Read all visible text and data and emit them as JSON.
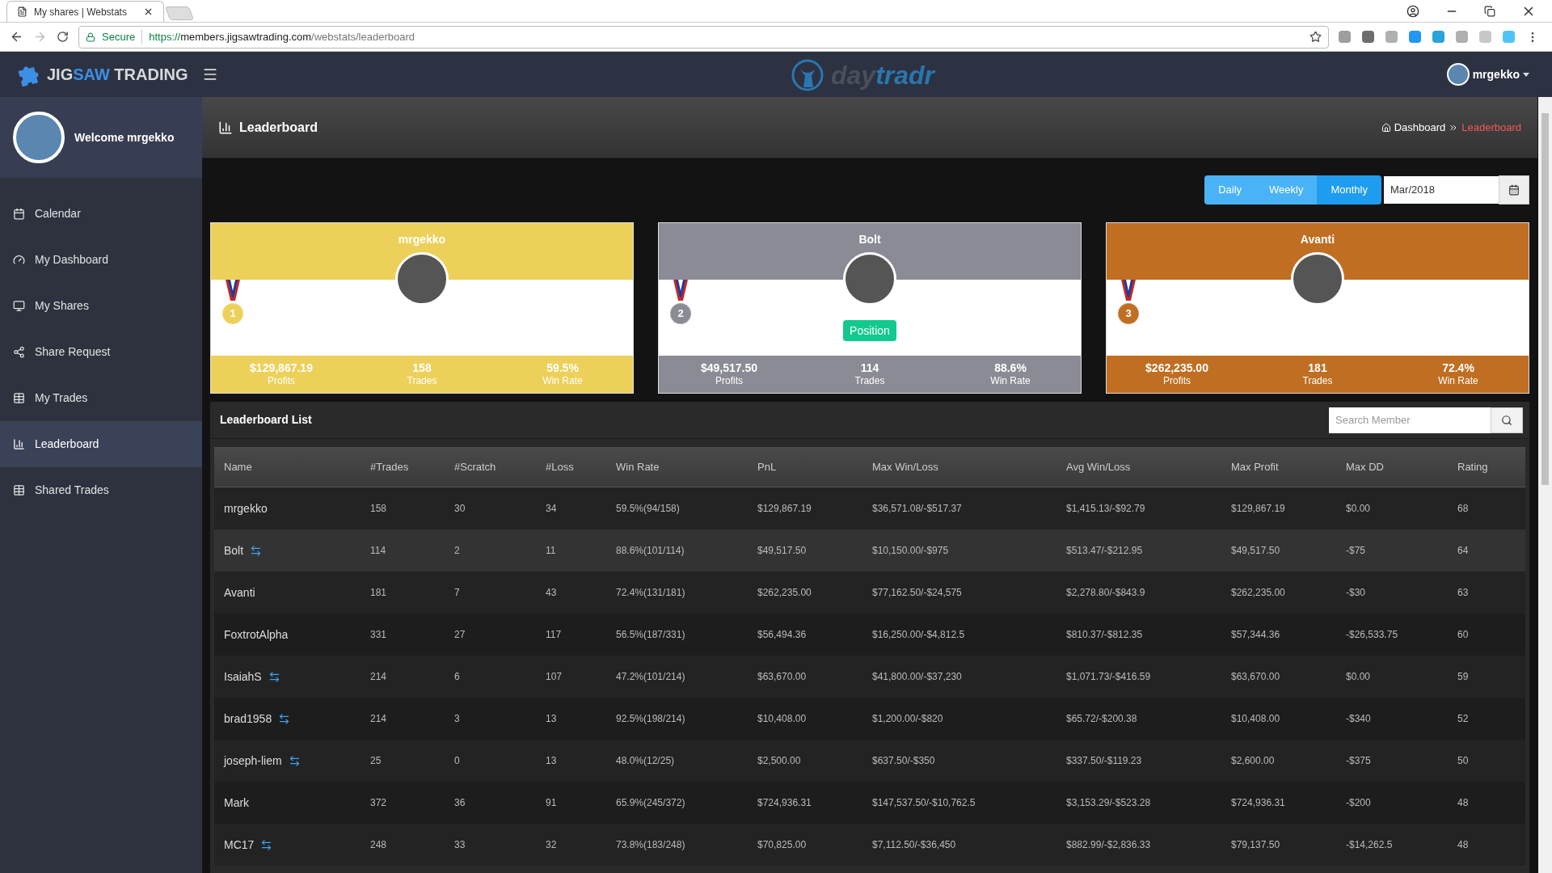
{
  "browser": {
    "tab_title": "My shares | Webstats",
    "secure_label": "Secure",
    "url": {
      "scheme": "https://",
      "host": "members.jigsawtrading.com",
      "path": "/webstats/leaderboard"
    }
  },
  "header": {
    "logo": {
      "part_1": "JIG",
      "accent": "SAW",
      "part_2": " TRADING"
    },
    "center_logo": {
      "part_1": "day",
      "accent": "tradr"
    },
    "user": "mrgekko"
  },
  "sidebar": {
    "welcome": "Welcome mrgekko",
    "items": [
      {
        "label": "Calendar",
        "selected": false
      },
      {
        "label": "My Dashboard",
        "selected": false
      },
      {
        "label": "My Shares",
        "selected": false
      },
      {
        "label": "Share Request",
        "selected": false
      },
      {
        "label": "My Trades",
        "selected": false
      },
      {
        "label": "Leaderboard",
        "selected": true
      },
      {
        "label": "Shared Trades",
        "selected": false
      }
    ]
  },
  "page": {
    "title": "Leaderboard",
    "breadcrumb": [
      {
        "label": "Dashboard",
        "selected": false
      },
      {
        "label": "Leaderboard",
        "selected": true
      }
    ]
  },
  "period": {
    "buttons": [
      {
        "label": "Daily",
        "selected": false
      },
      {
        "label": "Weekly",
        "selected": false
      },
      {
        "label": "Monthly",
        "selected": true
      }
    ],
    "date_value": "Mar/2018"
  },
  "podium": [
    {
      "name": "mrgekko",
      "rank": "1",
      "color": "#edd05a",
      "stats": [
        {
          "value": "$129,867.19",
          "label": "Profits"
        },
        {
          "value": "158",
          "label": "Trades"
        },
        {
          "value": "59.5%",
          "label": "Win Rate"
        }
      ]
    },
    {
      "name": "Bolt",
      "rank": "2",
      "color": "#8a8b94",
      "position_button": "Position",
      "stats": [
        {
          "value": "$49,517.50",
          "label": "Profits"
        },
        {
          "value": "114",
          "label": "Trades"
        },
        {
          "value": "88.6%",
          "label": "Win Rate"
        }
      ]
    },
    {
      "name": "Avanti",
      "rank": "3",
      "color": "#bf6e22",
      "stats": [
        {
          "value": "$262,235.00",
          "label": "Profits"
        },
        {
          "value": "181",
          "label": "Trades"
        },
        {
          "value": "72.4%",
          "label": "Win Rate"
        }
      ]
    }
  ],
  "list": {
    "title": "Leaderboard List",
    "search_placeholder": "Search Member",
    "columns": [
      "Name",
      "#Trades",
      "#Scratch",
      "#Loss",
      "Win Rate",
      "PnL",
      "Max Win/Loss",
      "Avg Win/Loss",
      "Max Profit",
      "Max DD",
      "Rating"
    ],
    "rows": [
      {
        "shared": false,
        "selected": false,
        "cells": [
          "mrgekko",
          "158",
          "30",
          "34",
          "59.5%(94/158)",
          "$129,867.19",
          "$36,571.08/-$517.37",
          "$1,415.13/-$92.79",
          "$129,867.19",
          "$0.00",
          "68"
        ]
      },
      {
        "shared": true,
        "selected": true,
        "cells": [
          "Bolt",
          "114",
          "2",
          "11",
          "88.6%(101/114)",
          "$49,517.50",
          "$10,150.00/-$975",
          "$513.47/-$212.95",
          "$49,517.50",
          "-$75",
          "64"
        ]
      },
      {
        "shared": false,
        "selected": false,
        "cells": [
          "Avanti",
          "181",
          "7",
          "43",
          "72.4%(131/181)",
          "$262,235.00",
          "$77,162.50/-$24,575",
          "$2,278.80/-$843.9",
          "$262,235.00",
          "-$30",
          "63"
        ]
      },
      {
        "shared": false,
        "selected": false,
        "cells": [
          "FoxtrotAlpha",
          "331",
          "27",
          "117",
          "56.5%(187/331)",
          "$56,494.36",
          "$16,250.00/-$4,812.5",
          "$810.37/-$812.35",
          "$57,344.36",
          "-$26,533.75",
          "60"
        ]
      },
      {
        "shared": true,
        "selected": false,
        "cells": [
          "IsaiahS",
          "214",
          "6",
          "107",
          "47.2%(101/214)",
          "$63,670.00",
          "$41,800.00/-$37,230",
          "$1,071.73/-$416.59",
          "$63,670.00",
          "$0.00",
          "59"
        ]
      },
      {
        "shared": true,
        "selected": false,
        "cells": [
          "brad1958",
          "214",
          "3",
          "13",
          "92.5%(198/214)",
          "$10,408.00",
          "$1,200.00/-$820",
          "$65.72/-$200.38",
          "$10,408.00",
          "-$340",
          "52"
        ]
      },
      {
        "shared": true,
        "selected": false,
        "cells": [
          "joseph-liem",
          "25",
          "0",
          "13",
          "48.0%(12/25)",
          "$2,500.00",
          "$637.50/-$350",
          "$337.50/-$119.23",
          "$2,600.00",
          "-$375",
          "50"
        ]
      },
      {
        "shared": false,
        "selected": false,
        "cells": [
          "Mark",
          "372",
          "36",
          "91",
          "65.9%(245/372)",
          "$724,936.31",
          "$147,537.50/-$10,762.5",
          "$3,153.29/-$523.28",
          "$724,936.31",
          "-$200",
          "48"
        ]
      },
      {
        "shared": true,
        "selected": false,
        "cells": [
          "MC17",
          "248",
          "33",
          "32",
          "73.8%(183/248)",
          "$70,825.00",
          "$7,112.50/-$36,450",
          "$882.99/-$2,836.33",
          "$79,137.50",
          "-$14,262.5",
          "48"
        ]
      }
    ]
  }
}
